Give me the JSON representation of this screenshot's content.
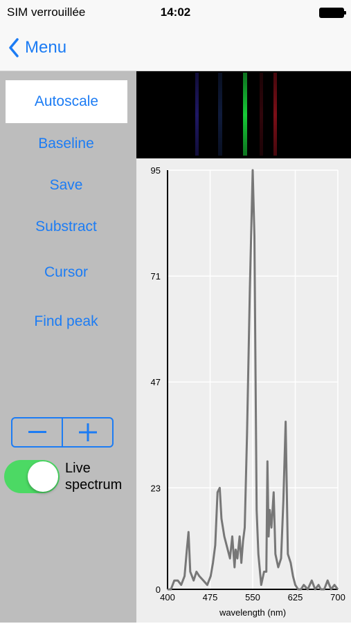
{
  "status_bar": {
    "carrier": "SIM verrouillée",
    "time": "14:02"
  },
  "nav": {
    "back_label": "Menu"
  },
  "sidebar": {
    "buttons": [
      {
        "label": "Autoscale",
        "active": true
      },
      {
        "label": "Baseline"
      },
      {
        "label": "Save"
      },
      {
        "label": "Substract"
      },
      {
        "label": "Cursor"
      },
      {
        "label": "Find peak"
      }
    ],
    "stepper": {
      "minus_icon": "minus-icon",
      "plus_icon": "plus-icon"
    },
    "live_toggle": {
      "on": true,
      "label_line1": "Live",
      "label_line2": "spectrum"
    }
  },
  "colors": {
    "accent": "#1c7cf4",
    "toggle_on": "#4cd964",
    "sidebar_bg": "#bdbdbd",
    "plot_bg": "#eeeeee",
    "line": "#777777"
  },
  "spectrum_bands": [
    {
      "color": "#3b2ec8",
      "intensity": 0.5
    },
    {
      "color": "#2b4ca8",
      "intensity": 0.35
    },
    {
      "color": "#18d43a",
      "intensity": 0.95
    },
    {
      "color": "#8a1020",
      "intensity": 0.35
    },
    {
      "color": "#e01a2a",
      "intensity": 0.55
    }
  ],
  "chart_data": {
    "type": "line",
    "xlabel": "wavelength (nm)",
    "xlim": [
      400,
      700
    ],
    "ylim": [
      0,
      95
    ],
    "xticks": [
      "400",
      "475",
      "550",
      "625",
      "700"
    ],
    "yticks": [
      "0",
      "23",
      "47",
      "71",
      "95"
    ],
    "grid": true,
    "series": [
      {
        "x": [
          400,
          406,
          412,
          418,
          424,
          430,
          434,
          437,
          440,
          443,
          446,
          451,
          456,
          463,
          470,
          476,
          480,
          484,
          488,
          492,
          495,
          500,
          504,
          510,
          514,
          518,
          520,
          523,
          527,
          530,
          533,
          536,
          540,
          545,
          550,
          553,
          557,
          560,
          565,
          570,
          574,
          576,
          578,
          580,
          583,
          587,
          590,
          595,
          600,
          604,
          608,
          612,
          617,
          621,
          625,
          630,
          635,
          640,
          647,
          654,
          660,
          666,
          670,
          676,
          682,
          688,
          694,
          700
        ],
        "y": [
          0,
          0,
          2,
          2,
          1,
          3,
          9,
          13,
          4,
          3,
          2,
          4,
          3,
          2,
          1,
          3,
          6,
          10,
          22,
          23,
          16,
          12,
          10,
          7,
          12,
          5,
          9,
          7,
          12,
          6,
          11,
          14,
          35,
          68,
          95,
          80,
          18,
          8,
          1,
          4,
          4,
          29,
          12,
          18,
          14,
          22,
          8,
          5,
          7,
          20,
          38,
          8,
          6,
          3,
          1,
          0,
          0,
          1,
          0,
          2,
          0,
          1,
          0,
          0,
          2,
          0,
          1,
          0
        ]
      }
    ]
  }
}
